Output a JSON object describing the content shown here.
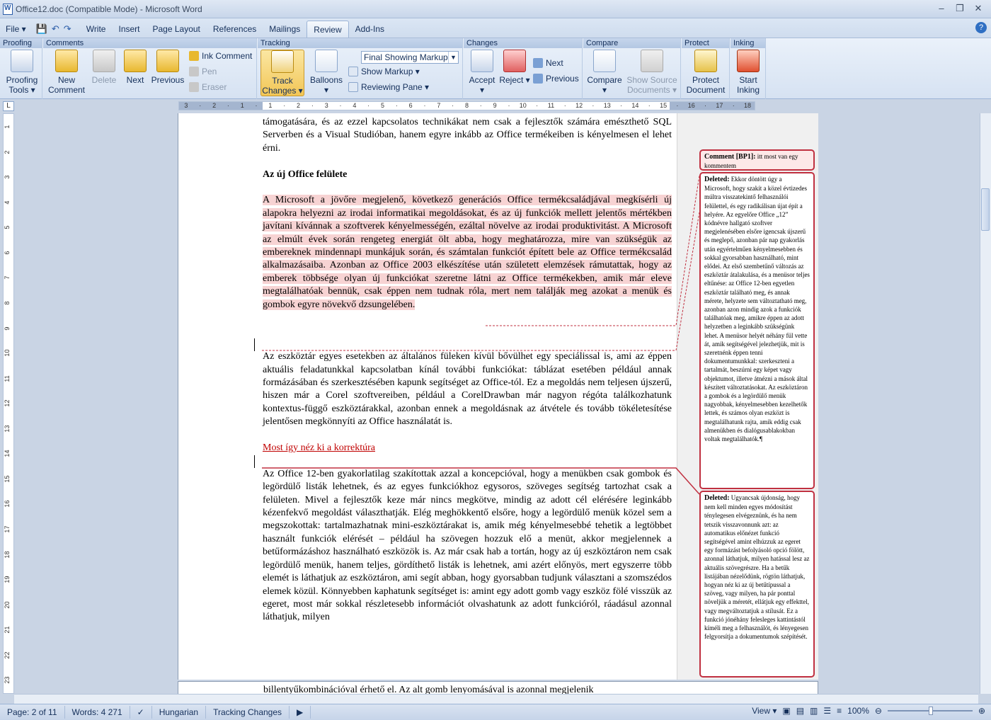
{
  "titlebar": {
    "title": "Office12.doc (Compatible Mode) - Microsoft Word",
    "min": "–",
    "max": "❐",
    "close": "✕"
  },
  "menubar": {
    "file": "File ▾",
    "tabs": [
      "Write",
      "Insert",
      "Page Layout",
      "References",
      "Mailings",
      "Review",
      "Add-Ins"
    ],
    "active_tab": "Review",
    "help": "?"
  },
  "ribbon": {
    "groups": {
      "proofing": "Proofing",
      "comments": "Comments",
      "tracking": "Tracking",
      "changes": "Changes",
      "compare": "Compare",
      "protect": "Protect",
      "inking": "Inking"
    },
    "proofing_tools": "Proofing Tools ▾",
    "new_comment": "New Comment",
    "delete": "Delete",
    "next": "Next",
    "previous": "Previous",
    "ink_comment": "Ink Comment",
    "pen": "Pen",
    "eraser": "Eraser",
    "track_changes": "Track Changes ▾",
    "balloons": "Balloons ▾",
    "markup_select": "Final Showing Markup",
    "show_markup": "Show Markup ▾",
    "reviewing_pane": "Reviewing Pane ▾",
    "accept": "Accept ▾",
    "reject": "Reject ▾",
    "change_next": "Next",
    "change_previous": "Previous",
    "compare": "Compare ▾",
    "show_source": "Show Source Documents ▾",
    "protect_document": "Protect Document",
    "start_inking": "Start Inking"
  },
  "ruler": {
    "h_ticks": [
      "3",
      "·",
      "2",
      "·",
      "1",
      "·",
      "1",
      "·",
      "2",
      "·",
      "3",
      "·",
      "4",
      "·",
      "5",
      "·",
      "6",
      "·",
      "7",
      "·",
      "8",
      "·",
      "9",
      "·",
      "10",
      "·",
      "11",
      "·",
      "12",
      "·",
      "13",
      "·",
      "14",
      "·",
      "15",
      "·",
      "16",
      "·",
      "17",
      "·",
      "18"
    ],
    "v_ticks": [
      "1",
      "2",
      "3",
      "4",
      "5",
      "6",
      "7",
      "8",
      "9",
      "10",
      "11",
      "12",
      "13",
      "14",
      "15",
      "16",
      "17",
      "18",
      "19",
      "20",
      "21",
      "22",
      "23"
    ]
  },
  "document": {
    "para1": "támogatására, és az ezzel kapcsolatos technikákat nem csak a fejlesztők számára emészthető SQL Serverben és a Visual Studióban, hanem egyre inkább az Office termékeiben is kényelmesen el lehet érni.",
    "heading": "Az új Office felülete",
    "para2_inserted": "A Microsoft a jövőre megjelenő, következő generációs Office termékcsaládjával megkísérli új alapokra helyezni az irodai informatikai megoldásokat, és az új funkciók mellett jelentős mértékben javítani kívánnak a szoftverek kényelmességén, ezáltal növelve az irodai produktivitást. A Microsoft az elmúlt évek során rengeteg energiát ölt abba, hogy meghatározza, mire van szükségük az embereknek mindennapi munkájuk során, és számtalan funkciót épített bele az Office termékcsalád alkalmazásaiba. Azonban az Office 2003 elkészítése után született elemzések rámutattak, hogy az emberek többsége olyan új funkciókat szeretne látni az Office termékekben, amik már eleve megtalálhatóak bennük, csak éppen nem tudnak róla, mert nem találják meg azokat a menük és gombok egyre növekvő dzsungelében.",
    "para3": "Az eszköztár egyes esetekben az általános füleken kívül bővülhet egy speciálissal is, ami az éppen aktuális feladatunkkal kapcsolatban kínál további funkciókat: táblázat esetében például annak formázásában és szerkesztésében kapunk segítséget az Office-tól. Ez a megoldás nem teljesen újszerű, hiszen már a Corel szoftvereiben, például a CorelDrawban már nagyon régóta találkozhatunk kontextus-függő eszköztárakkal, azonban ennek a megoldásnak az átvétele és tovább tökéletesítése jelentősen megkönnyíti az Office használatát is.",
    "inserted_heading": "Most így néz ki a korrektúra",
    "para4": "Az Office 12-ben gyakorlatilag szakítottak azzal a koncepcióval, hogy a menükben csak gombok és legördülő listák lehetnek, és az egyes funkciókhoz egysoros, szöveges segítség tartozhat csak a felületen. Mivel a fejlesztők keze már nincs megkötve, mindig az adott cél elérésére leginkább kézenfekvő megoldást választhatják. Elég meghökkentő elsőre, hogy a legördülő menük közel sem a megszokottak: tartalmazhatnak mini-eszköztárakat is, amik még kényelmesebbé tehetik a legtöbbet használt funkciók elérését – például ha szövegen hozzuk elő a menüt, akkor megjelennek a betűformázáshoz használható eszközök is. Az már csak hab a tortán, hogy az új eszköztáron nem csak legördülő menük, hanem teljes, gördíthető listák is lehetnek, ami azért előnyös, mert egyszerre több elemét is láthatjuk az eszköztáron, ami segít abban, hogy gyorsabban tudjunk választani a szomszédos elemek közül. Könnyebben kaphatunk segítséget is: amint egy adott gomb vagy eszköz fölé visszük az egeret, most már sokkal részletesebb információt olvashatunk az adott funkcióról, ráadásul azonnal láthatjuk, milyen",
    "page2_line": "billentyűkombinációval érhető el. Az alt gomb lenyomásával is azonnal megjelenik"
  },
  "balloons": {
    "comment_label": "Comment [BP1]:",
    "comment_text": "itt most van egy kommentem",
    "deleted1_label": "Deleted:",
    "deleted1_text": "Ekkor döntött úgy a Microsoft, hogy szakít a közel évtizedes múltra visszatekintő felhasználói felülettel, és egy radikálisan újat épít a helyére. Az egyelőre Office „12” kódnévre hallgató szoftver megjelenésében elsőre igencsak újszerű és meglepő, azonban pár nap gyakorlás után egyértelműen kényelmesebben és sokkal gyorsabban használható, mint elődei. Az első szembetűnő változás az eszköztár átalakulása, és a menüsor teljes eltűnése: az Office 12-ben egyetlen eszköztár található meg, és annak mérete, helyzete sem változtatható meg, azonban azon mindig azok a funkciók találhatóak meg, amikre éppen az adott helyzetben a leginkább szükségünk lehet. A menüsor helyét néhány fül vette át, amik segítségével jelezhetjük, mit is szeretnénk éppen tenni dokumentumunkkal: szerkeszteni a tartalmát, beszúrni egy képet vagy objektumot, illetve átnézni a mások által készített változtatásokat. Az eszköztáron a gombok és a legördülő menük nagyobbak, kényelmesebben kezelhetők lettek, és számos olyan eszközt is megtalálhatunk rajta, amik eddig csak almenükben és dialógusablakokban voltak megtalálhatók.¶",
    "deleted2_label": "Deleted:",
    "deleted2_text": "Ugyancsak újdonság, hogy nem kell minden egyes módosítást ténylegesen elvégeznünk, és ha nem tetszik visszavonnunk azt: az automatikus előnézet funkció segítségével amint elhúzzuk az egeret egy formázást befolyásoló opció fölött, azonnal láthatjuk, milyen hatással lesz az aktuális szövegrészre. Ha a betűk listájában nézelődünk, rögtön láthatjuk, hogyan néz ki az új betűtípussal a szöveg, vagy milyen, ha pár ponttal növeljük a méretét, ellátjuk egy effekttel, vagy megváltoztatjuk a stílusát. Ez a funkció jónéhány felesleges kattintástól kíméli meg a felhasználót, és lényegesen felgyorsítja a dokumentumok szépítését."
  },
  "statusbar": {
    "page": "Page: 2 of 11",
    "words": "Words: 4 271",
    "language": "Hungarian",
    "tracking": "Tracking Changes",
    "view": "View ▾",
    "zoom": "100%"
  },
  "colors": {
    "accent": "#c00000",
    "insert_bg": "#f7d3d3",
    "balloon_border": "#c03040"
  }
}
